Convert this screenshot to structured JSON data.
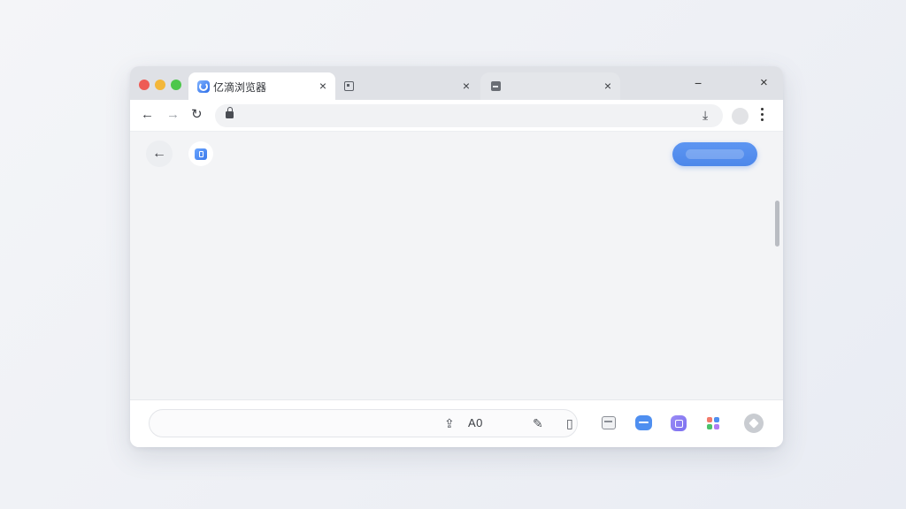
{
  "tabs": [
    {
      "title": "亿滴浏览器",
      "icon": "browser-logo-icon",
      "close": "×"
    },
    {
      "title": "",
      "icon": "page-icon",
      "close": "×"
    },
    {
      "title": "",
      "icon": "image-icon",
      "close": "×"
    }
  ],
  "window_controls": {
    "minimize": "−",
    "close": "×"
  },
  "toolbar": {
    "back": "←",
    "forward": "→",
    "reload": "↻",
    "url": "",
    "download": "⤓"
  },
  "page": {
    "back": "←"
  },
  "bottombar": {
    "input_value": "",
    "share_glyph": "⇪",
    "font_label": "A0",
    "pen_glyph": "✎",
    "book_glyph": "▯"
  },
  "colors": {
    "accent": "#4d87ea",
    "traffic_red": "#ee5b55",
    "traffic_yellow": "#f3b73a",
    "traffic_green": "#4dc74b"
  }
}
